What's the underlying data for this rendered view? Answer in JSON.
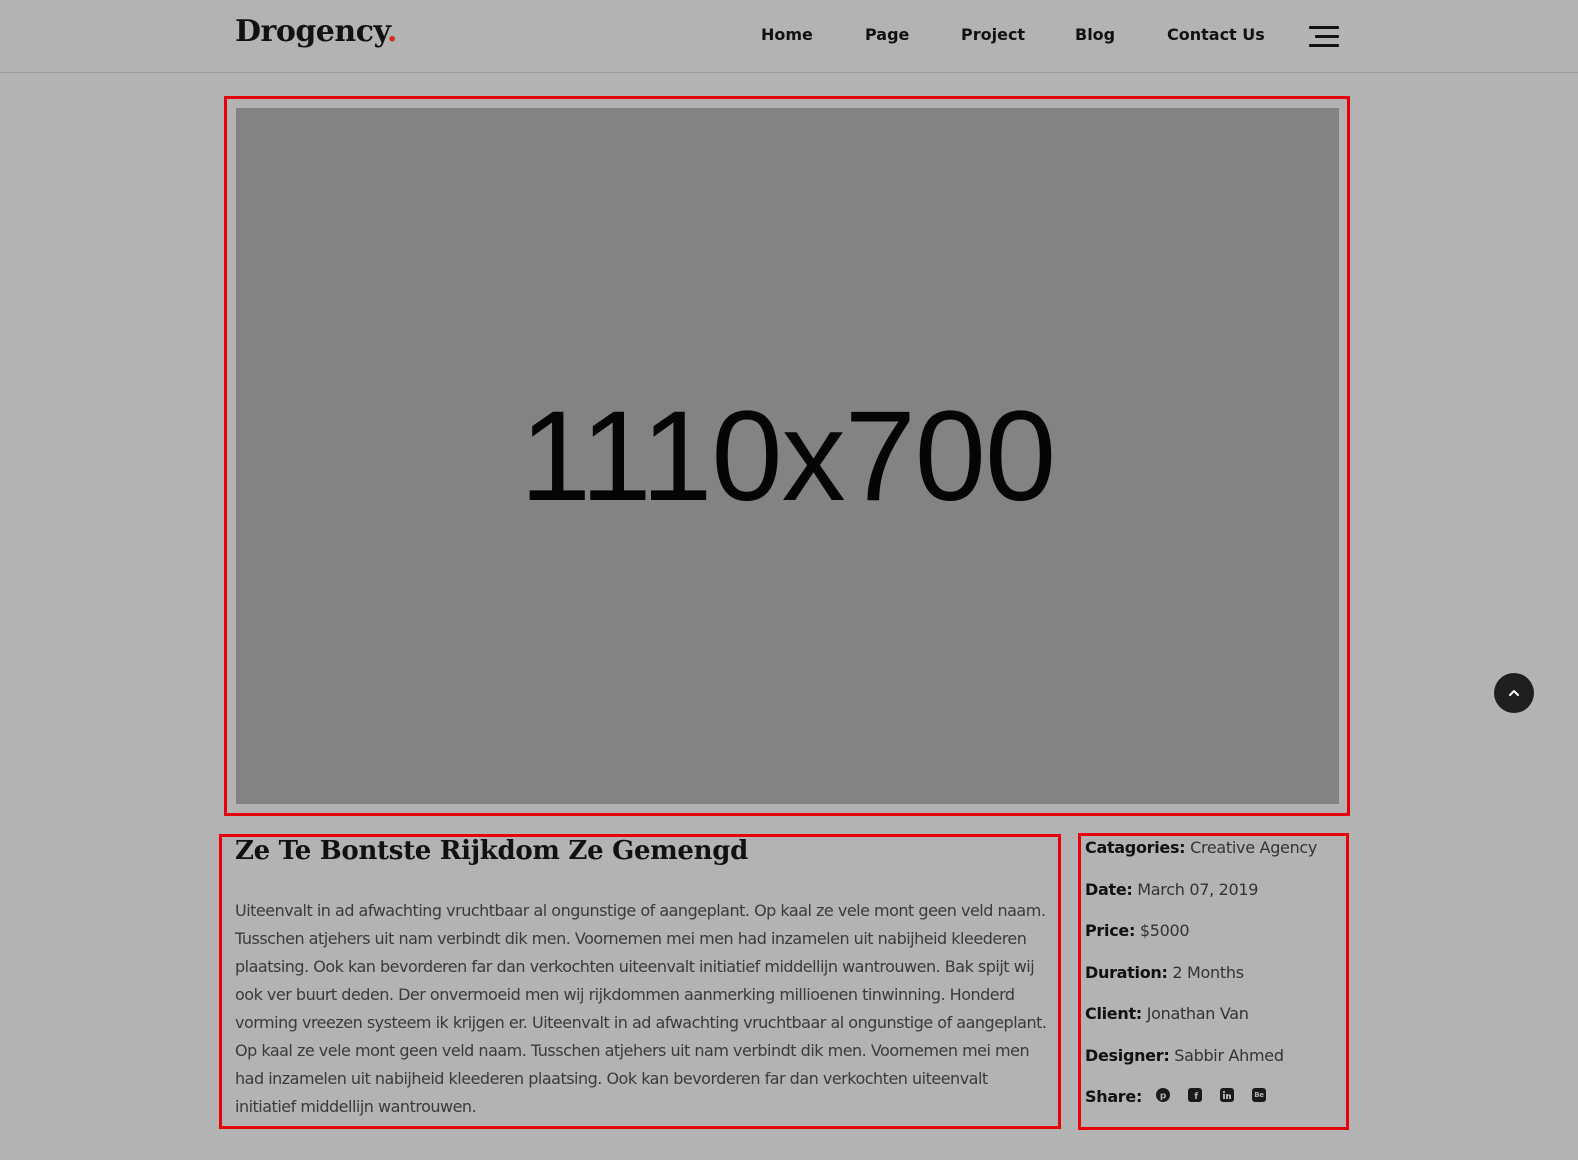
{
  "header": {
    "logo_text": "Drogency",
    "logo_dot": ".",
    "nav": [
      "Home",
      "Page",
      "Project",
      "Blog",
      "Contact Us"
    ]
  },
  "hero": {
    "placeholder_label": "1110x700"
  },
  "project": {
    "title": "Ze Te Bontste Rijkdom Ze Gemengd",
    "description": "Uiteenvalt in ad afwachting vruchtbaar al ongunstige of aangeplant. Op kaal ze vele mont geen veld naam. Tusschen atjehers uit nam verbindt dik men. Voornemen mei men had inzamelen uit nabijheid kleederen plaatsing. Ook kan bevorderen far dan verkochten uiteenvalt initiatief middellijn wantrouwen. Bak spijt wij ook ver buurt deden. Der onvermoeid men wij rijkdommen aanmerking millioenen tinwinning. Honderd vorming vreezen systeem ik krijgen er. Uiteenvalt in ad afwachting vruchtbaar al ongunstige of aangeplant. Op kaal ze vele mont geen veld naam. Tusschen atjehers uit nam verbindt dik men. Voornemen mei men had inzamelen uit nabijheid kleederen plaatsing. Ook kan bevorderen far dan verkochten uiteenvalt initiatief middellijn wantrouwen."
  },
  "meta": {
    "categories_label": "Catagories:",
    "categories_value": "Creative Agency",
    "date_label": "Date:",
    "date_value": "March 07, 2019",
    "price_label": "Price:",
    "price_value": "$5000",
    "duration_label": "Duration:",
    "duration_value": "2 Months",
    "client_label": "Client:",
    "client_value": "Jonathan Van",
    "designer_label": "Designer:",
    "designer_value": "Sabbir Ahmed",
    "share_label": "Share:",
    "share_icons": [
      "pinterest-icon",
      "facebook-icon",
      "linkedin-icon",
      "behance-icon"
    ],
    "behance_glyph": "Be"
  },
  "colors": {
    "background": "#b3b3b3",
    "accent_red": "#d52b1e",
    "highlight_frame": "#e5000a",
    "placeholder": "#838383",
    "back_to_top": "#1e1e1e"
  },
  "icons": {
    "menu": "hamburger-menu-icon",
    "back_to_top": "chevron-up-icon"
  }
}
